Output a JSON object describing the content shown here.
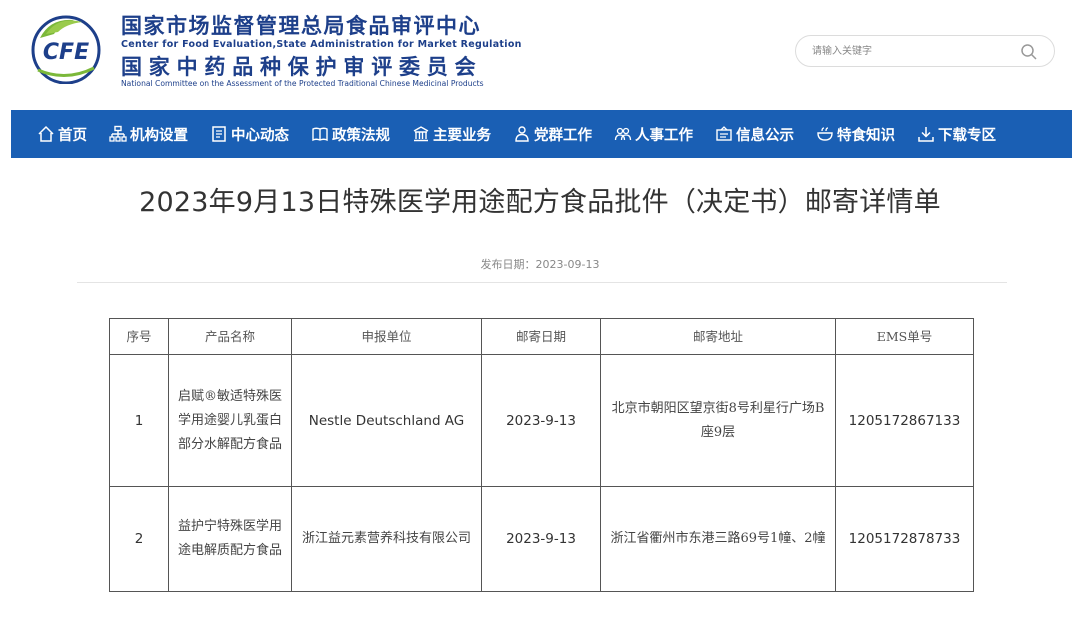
{
  "header": {
    "logo_text": "CFE",
    "org_cn_1": "国家市场监督管理总局食品审评中心",
    "org_en_1": "Center for Food Evaluation,State Administration for Market Regulation",
    "org_cn_2": "国家中药品种保护审评委员会",
    "org_en_2": "National Committee on the Assessment of the Protected Traditional Chinese Medicinal Products",
    "search_placeholder": "请输入关键字"
  },
  "nav": {
    "items": [
      {
        "label": "首页",
        "icon": "home-icon"
      },
      {
        "label": "机构设置",
        "icon": "org-chart-icon"
      },
      {
        "label": "中心动态",
        "icon": "news-icon"
      },
      {
        "label": "政策法规",
        "icon": "book-icon"
      },
      {
        "label": "主要业务",
        "icon": "building-icon"
      },
      {
        "label": "党群工作",
        "icon": "person-icon"
      },
      {
        "label": "人事工作",
        "icon": "people-icon"
      },
      {
        "label": "信息公示",
        "icon": "notice-icon"
      },
      {
        "label": "特食知识",
        "icon": "bowl-icon"
      },
      {
        "label": "下载专区",
        "icon": "download-icon"
      }
    ]
  },
  "article": {
    "title": "2023年9月13日特殊医学用途配方食品批件（决定书）邮寄详情单",
    "pub_date": "发布日期：2023-09-13"
  },
  "table": {
    "headers": [
      "序号",
      "产品名称",
      "申报单位",
      "邮寄日期",
      "邮寄地址",
      "EMS单号"
    ],
    "rows": [
      {
        "no": "1",
        "product": "启赋®敏适特殊医学用途婴儿乳蛋白部分水解配方食品",
        "applicant": "Nestle Deutschland AG",
        "date": "2023-9-13",
        "address": "北京市朝阳区望京街8号利星行广场B座9层",
        "ems": "1205172867133"
      },
      {
        "no": "2",
        "product": "益护宁特殊医学用途电解质配方食品",
        "applicant": "浙江益元素营养科技有限公司",
        "date": "2023-9-13",
        "address": "浙江省衢州市东港三路69号1幢、2幢",
        "ems": "1205172878733"
      }
    ]
  }
}
